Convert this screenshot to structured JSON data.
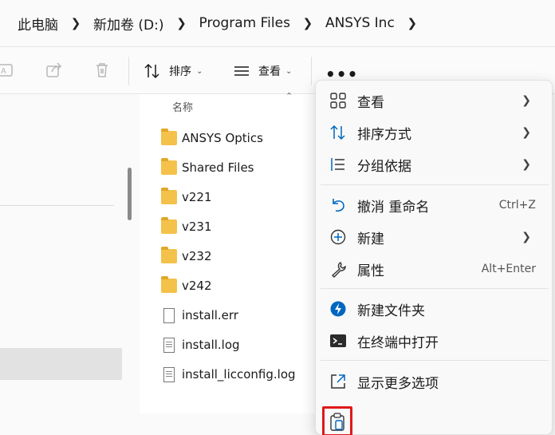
{
  "breadcrumb": {
    "items": [
      "此电脑",
      "新加卷 (D:)",
      "Program Files",
      "ANSYS Inc"
    ]
  },
  "toolbar": {
    "sort_label": "排序",
    "view_label": "查看",
    "more_label": "•••"
  },
  "file_list": {
    "column_name": "名称",
    "items": [
      {
        "name": "ANSYS Optics",
        "type": "folder"
      },
      {
        "name": "Shared Files",
        "type": "folder"
      },
      {
        "name": "v221",
        "type": "folder"
      },
      {
        "name": "v231",
        "type": "folder"
      },
      {
        "name": "v232",
        "type": "folder"
      },
      {
        "name": "v242",
        "type": "folder"
      },
      {
        "name": "install.err",
        "type": "file"
      },
      {
        "name": "install.log",
        "type": "text"
      },
      {
        "name": "install_licconfig.log",
        "type": "text"
      }
    ]
  },
  "context_menu": {
    "items": [
      {
        "label": "查看",
        "icon": "grid-icon",
        "submenu": true
      },
      {
        "label": "排序方式",
        "icon": "sort-icon",
        "submenu": true
      },
      {
        "label": "分组依据",
        "icon": "group-icon",
        "submenu": true
      },
      {
        "label": "撤消 重命名",
        "icon": "undo-icon",
        "shortcut": "Ctrl+Z"
      },
      {
        "label": "新建",
        "icon": "new-icon",
        "submenu": true
      },
      {
        "label": "属性",
        "icon": "wrench-icon",
        "shortcut": "Alt+Enter"
      },
      {
        "label": "新建文件夹",
        "icon": "new-folder-icon"
      },
      {
        "label": "在终端中打开",
        "icon": "terminal-icon"
      },
      {
        "label": "显示更多选项",
        "icon": "more-options-icon"
      }
    ],
    "paste_icon": "paste-icon"
  },
  "colors": {
    "accent": "#0067c0",
    "folder": "#f4c24a",
    "highlight_border": "#e01818"
  }
}
